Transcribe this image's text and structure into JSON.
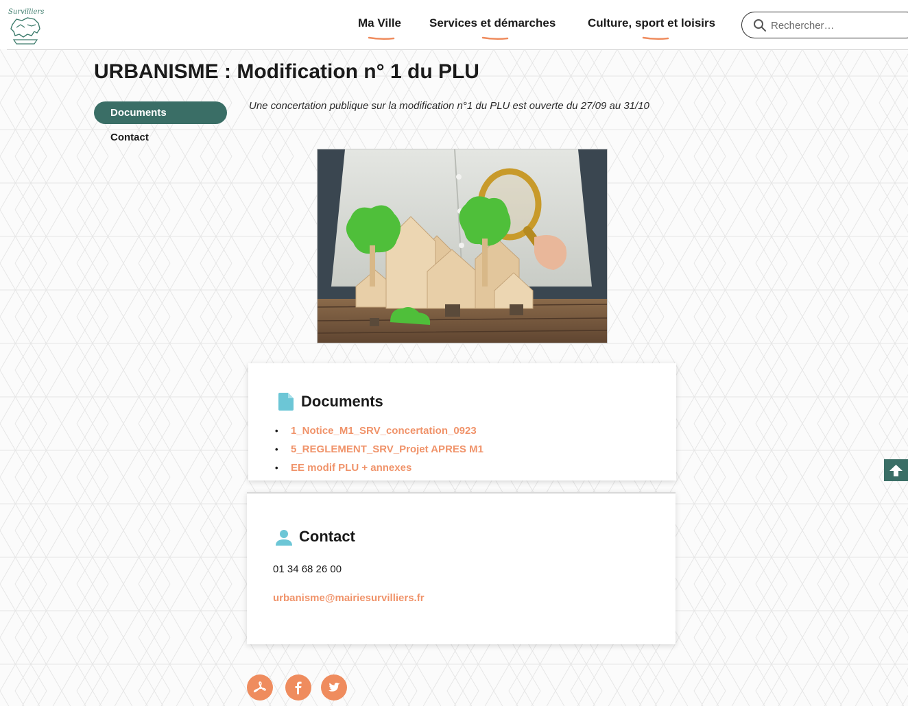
{
  "header": {
    "logo_text": "Survilliers",
    "nav": [
      {
        "label": "Ma Ville"
      },
      {
        "label": "Services et démarches"
      },
      {
        "label": "Culture, sport et loisirs"
      }
    ],
    "search": {
      "placeholder": "Rechercher…"
    }
  },
  "page": {
    "title": "URBANISME : Modification n° 1 du PLU",
    "side_nav": [
      {
        "label": "Documents",
        "active": true
      },
      {
        "label": "Contact",
        "active": false
      }
    ],
    "intro": "Une concertation publique sur la modification n°1 du PLU est ouverte du 27/09 au 31/10"
  },
  "documents": {
    "heading": "Documents",
    "icon": "document-icon",
    "items": [
      {
        "label": "1_Notice_M1_SRV_concertation_0923"
      },
      {
        "label": "5_REGLEMENT_SRV_Projet APRES M1"
      },
      {
        "label": "EE modif PLU + annexes"
      }
    ]
  },
  "contact": {
    "heading": "Contact",
    "icon": "person-icon",
    "phone": "01 34 68 26 00",
    "email": "urbanisme@mairiesurvilliers.fr"
  },
  "social": [
    "pdf-icon",
    "facebook-icon",
    "twitter-icon"
  ],
  "colors": {
    "accent": "#f0936a",
    "brand_green": "#3a6e66",
    "icon_teal": "#6cc6d6"
  }
}
